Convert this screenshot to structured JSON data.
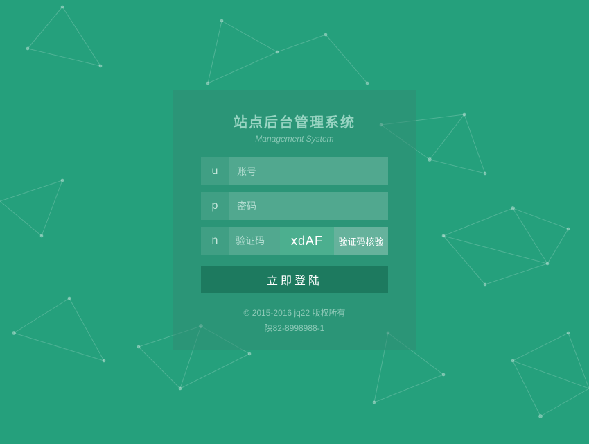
{
  "title": "站点后台管理系统",
  "subtitle": "Management System",
  "fields": {
    "username": {
      "icon": "u",
      "placeholder": "账号"
    },
    "password": {
      "icon": "p",
      "placeholder": "密码"
    },
    "captcha": {
      "icon": "n",
      "placeholder": "验证码",
      "code": "xdAF",
      "verify_label": "验证码核验"
    }
  },
  "login_button": "立即登陆",
  "footer": {
    "copyright": "© 2015-2016 jq22 版权所有",
    "icp": "陕82-8998988-1"
  }
}
